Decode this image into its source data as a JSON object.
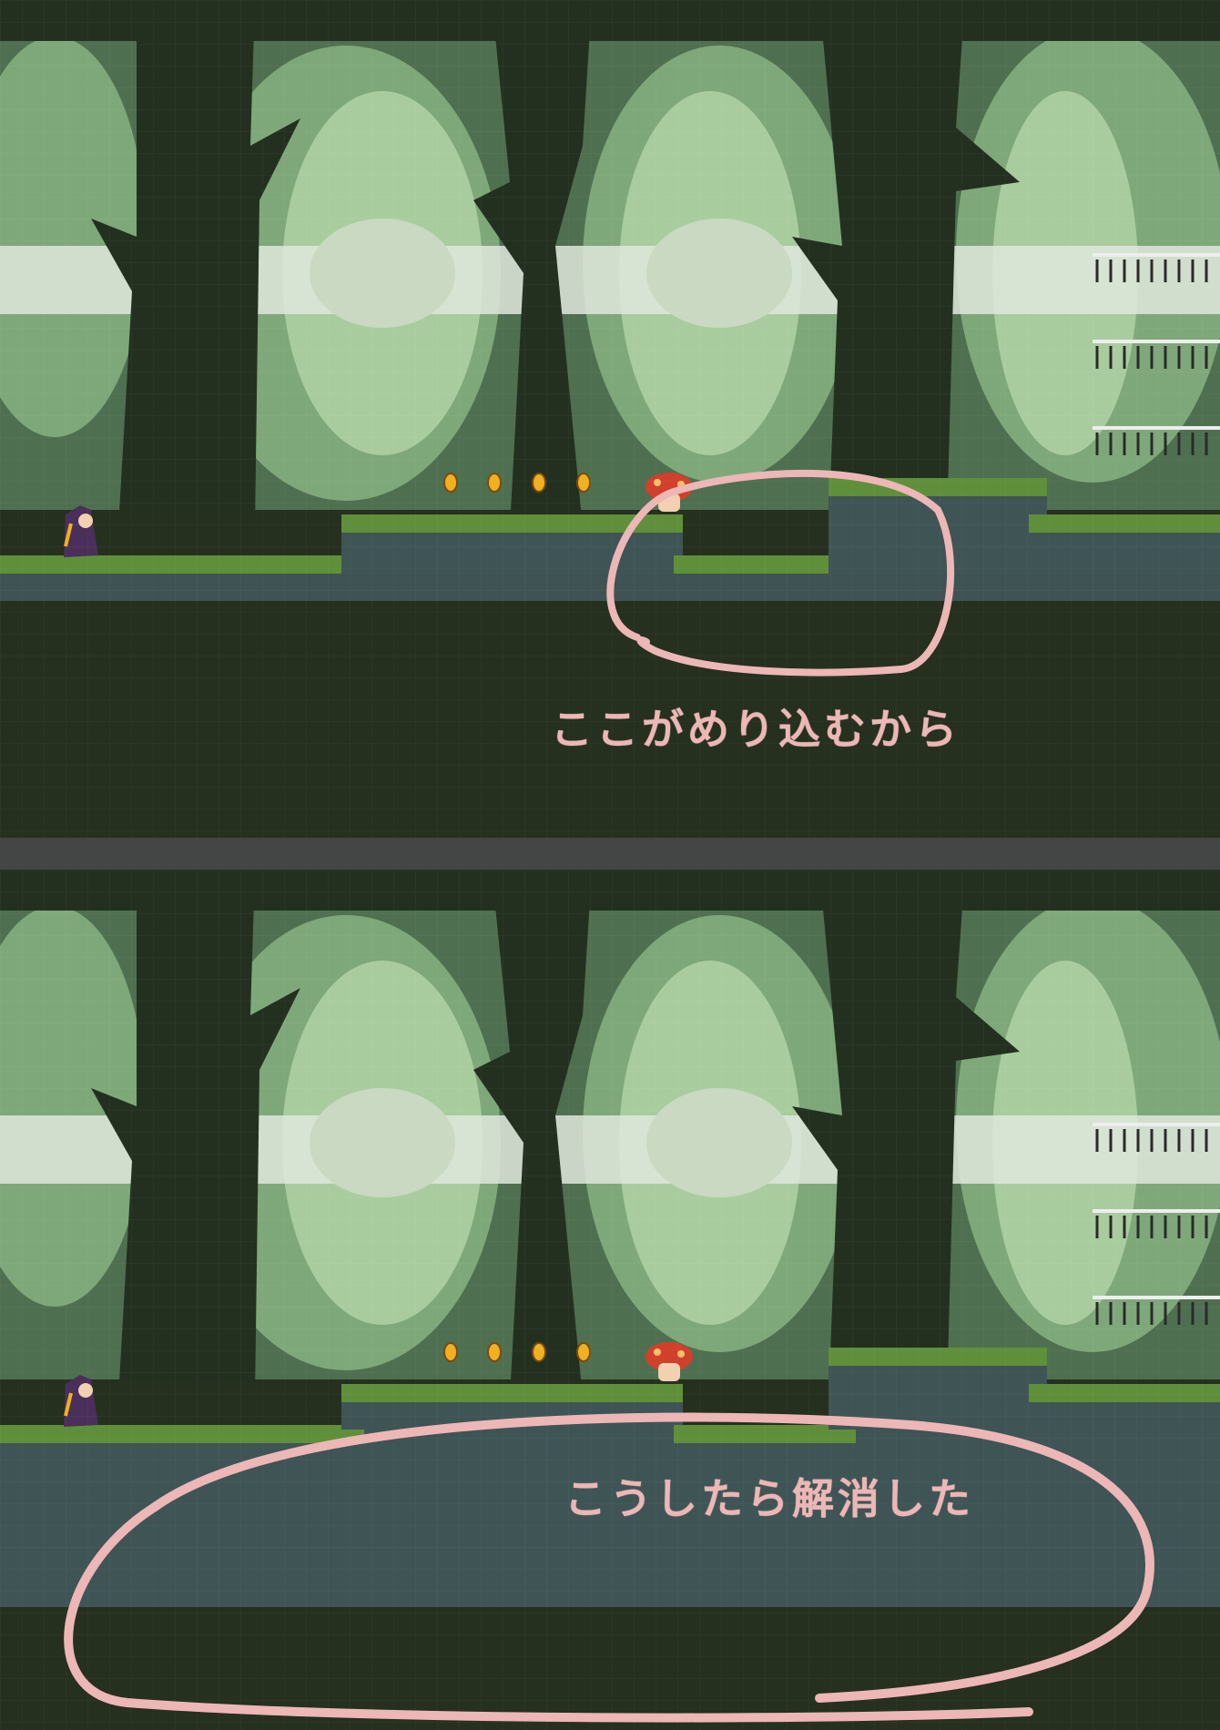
{
  "annotations": {
    "top": "ここがめり込むから",
    "bottom": "こうしたら解消した"
  },
  "colors": {
    "sky_dark": "#25301f",
    "tree_dark": "#233020",
    "foliage_mid": "#4f7050",
    "foliage_light": "#7fa87a",
    "foliage_pale": "#a9cc9f",
    "mist": "#dfe6dc",
    "ground_fill": "#3f5455",
    "grass": "#5f8f3a",
    "marker_pink": "#ecb7b6",
    "coin": "#f0b020"
  },
  "scene": {
    "coins_per_panel": 4,
    "characters": [
      "witch-player",
      "mushroom-enemy"
    ]
  }
}
